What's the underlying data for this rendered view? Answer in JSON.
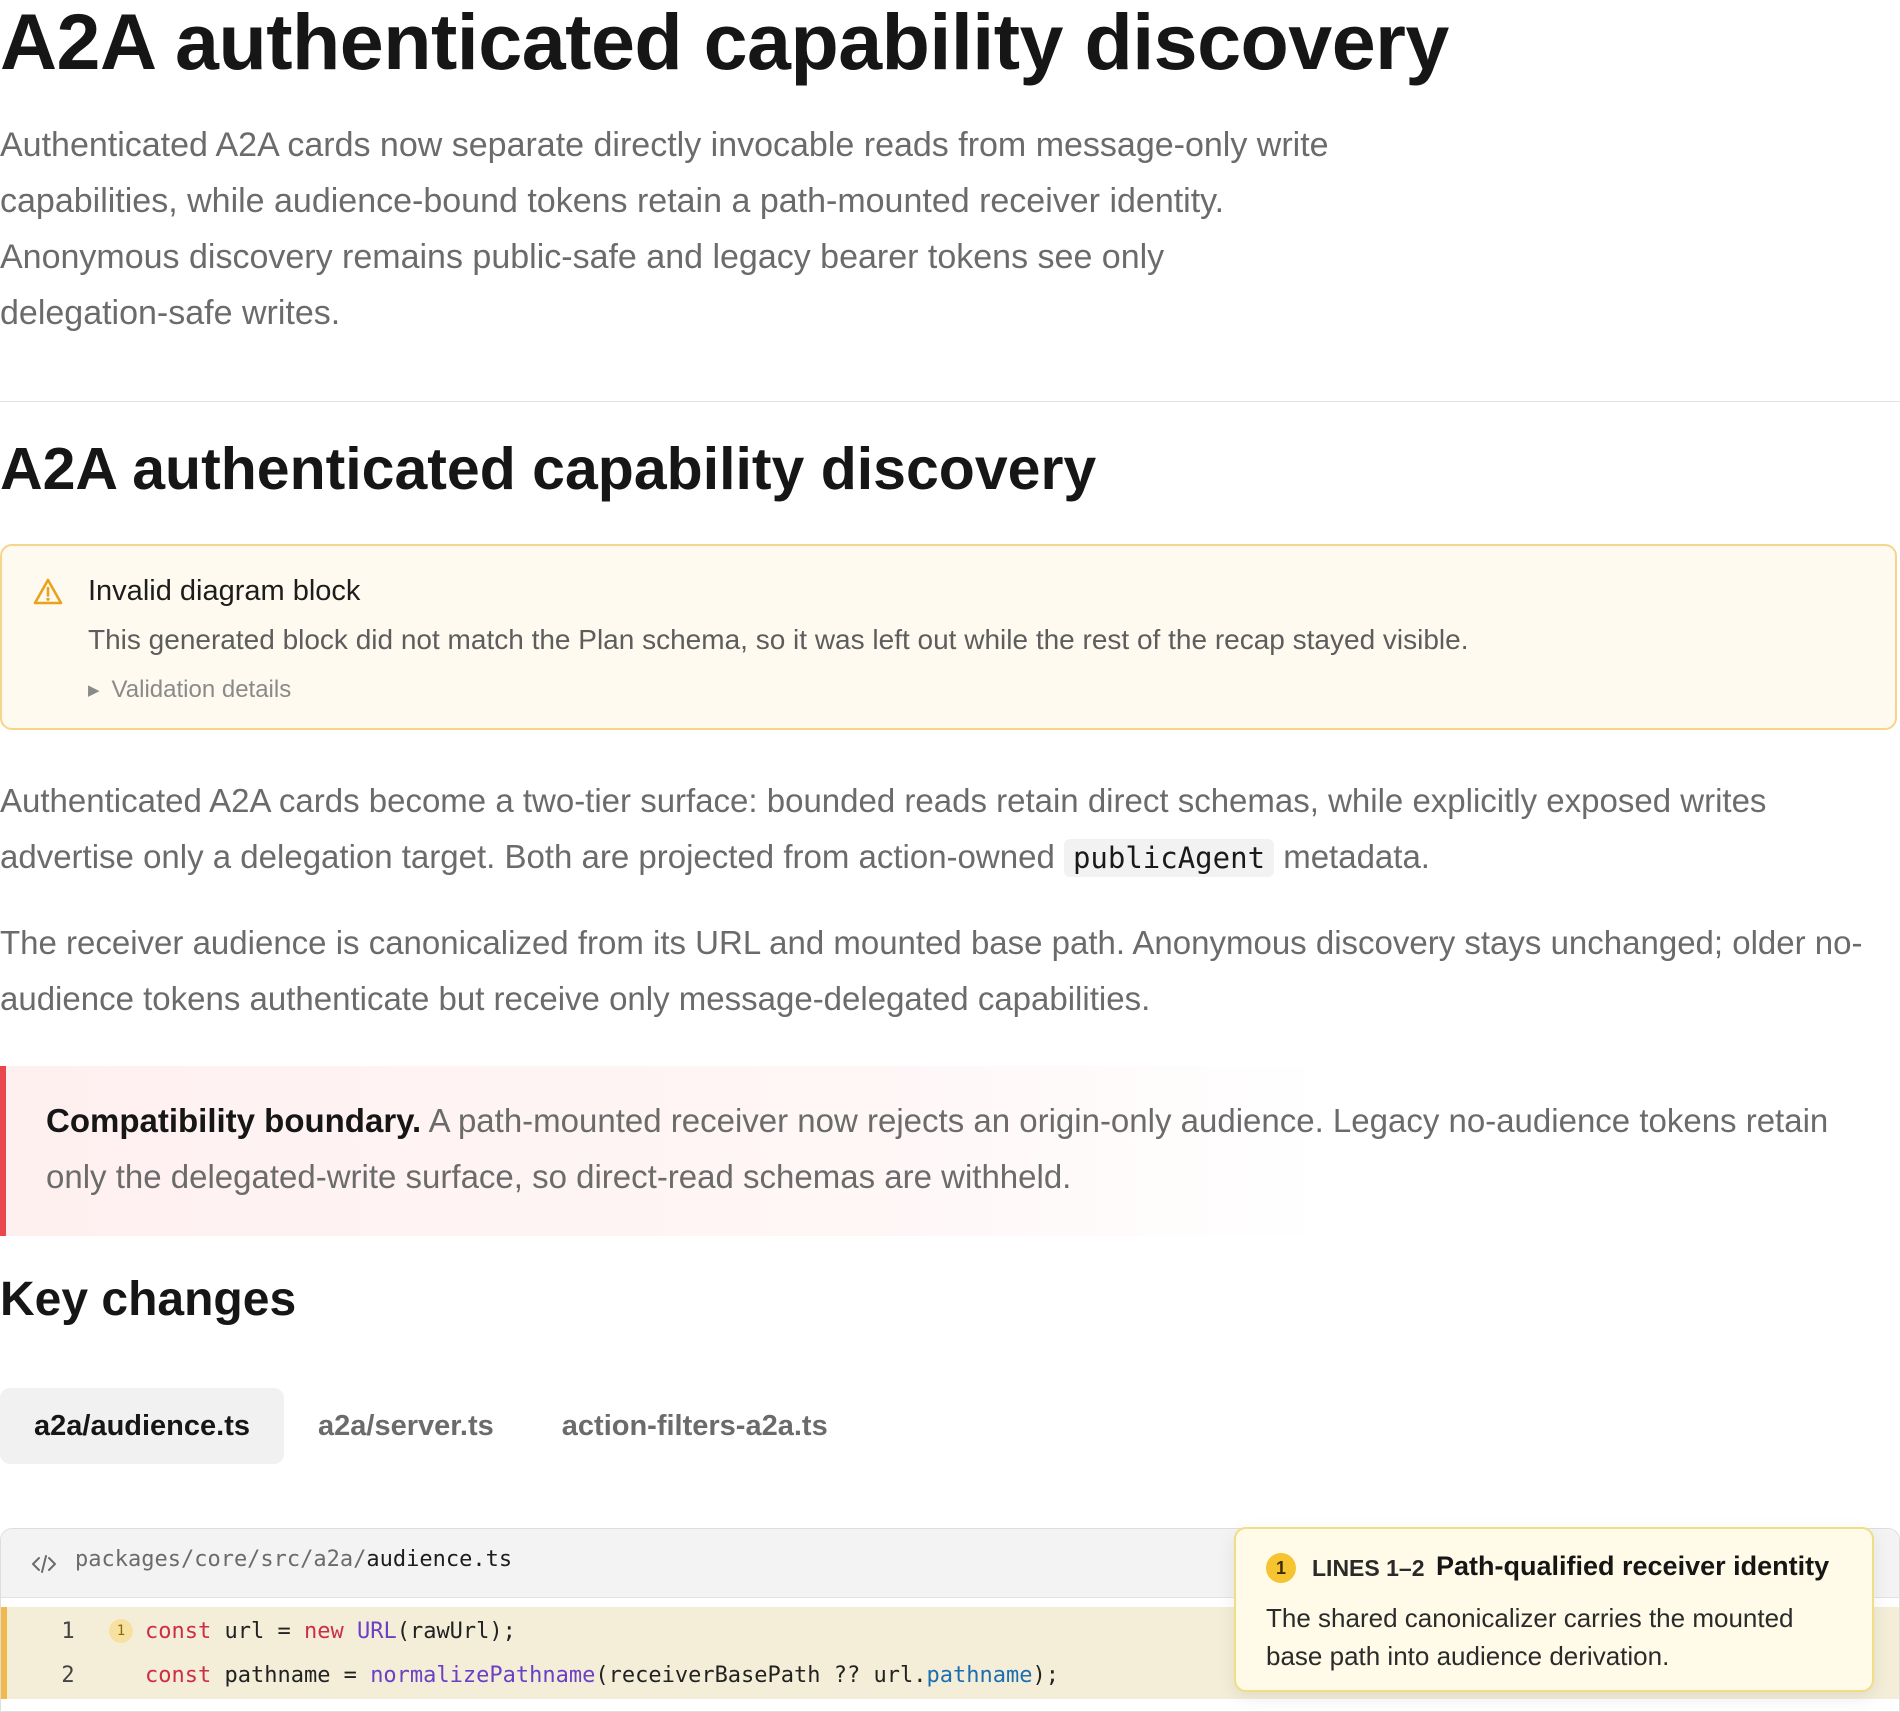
{
  "header": {
    "title": "A2A authenticated capability discovery",
    "intro": "Authenticated A2A cards now separate directly invocable reads from message-only write capabilities, while audience-bound tokens retain a path-mounted receiver identity. Anonymous discovery remains public-safe and legacy bearer tokens see only delegation-safe writes."
  },
  "section": {
    "title": "A2A authenticated capability discovery",
    "warning": {
      "title": "Invalid diagram block",
      "text": "This generated block did not match the Plan schema, so it was left out while the rest of the recap stayed visible.",
      "details_label": "Validation details"
    },
    "para1_before": "Authenticated A2A cards become a two-tier surface: bounded reads retain direct schemas, while explicitly exposed writes advertise only a delegation target. Both are projected from action-owned ",
    "para1_code": "publicAgent",
    "para1_after": " metadata.",
    "para2": "The receiver audience is canonicalized from its URL and mounted base path. Anonymous discovery stays unchanged; older no-audience tokens authenticate but receive only message-delegated capabilities.",
    "callout_label": "Compatibility boundary.",
    "callout_text": " A path-mounted receiver now rejects an origin-only audience. Legacy no-audience tokens retain only the delegated-write surface, so direct-read schemas are withheld."
  },
  "key_changes": {
    "title": "Key changes",
    "tabs": [
      {
        "label": "a2a/audience.ts",
        "active": true
      },
      {
        "label": "a2a/server.ts",
        "active": false
      },
      {
        "label": "action-filters-a2a.ts",
        "active": false
      }
    ]
  },
  "code": {
    "path_dir": "packages/core/src/a2a/",
    "path_file": "audience.ts",
    "lines": [
      {
        "number": "1",
        "marker": "1"
      },
      {
        "number": "2"
      }
    ],
    "tokens": {
      "l1": [
        "const",
        " url = ",
        "new",
        " ",
        "URL",
        "(rawUrl);"
      ],
      "l2": [
        "const",
        " pathname = ",
        "normalizePathname",
        "(receiverBasePath ?? url.",
        "pathname",
        ");"
      ]
    }
  },
  "annotation": {
    "badge": "1",
    "lines": "LINES 1–2",
    "title": "Path-qualified receiver identity",
    "text": "The shared canonicalizer carries the mounted base path into audience derivation."
  },
  "colors": {
    "warning_border": "#f4d58a",
    "callout_accent": "#e8484d",
    "code_keyword": "#cc2f45",
    "code_function": "#6b3fc6",
    "code_property": "#1b6fb0",
    "highlight_accent": "#f1b94c",
    "tooltip_badge": "#f6c431"
  }
}
